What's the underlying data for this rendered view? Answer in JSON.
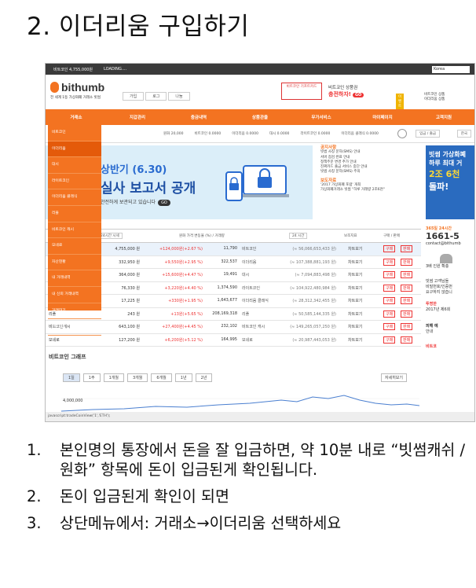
{
  "slide": {
    "title": "2. 이더리움 구입하기",
    "steps": [
      {
        "num": "1.",
        "text": "본인명의 통장에서 돈을 잘 입금하면, 약 10분 내로 “빗썸캐쉬 / 원화” 항목에 돈이 입금된게 확인됩니다."
      },
      {
        "num": "2.",
        "text": "돈이 입금된게 확인이 되면"
      },
      {
        "num": "3.",
        "text": "상단메뉴에서: 거래소→이더리움 선택하세요"
      }
    ]
  },
  "topbar": {
    "btc_price": "비트코인 4,755,000원",
    "loading": "LOADING....",
    "lang": "Korea"
  },
  "header": {
    "logo_text": "bithumb",
    "tagline": "전 세계 1등 가상화폐 거래소 빗썸",
    "buttons": [
      "가입",
      "로그",
      "나눔"
    ],
    "card_label": "비트코인 기프트카드",
    "ad_line1": "비트코인 상품권",
    "ad_line2": "충전하자!",
    "ad_go": "GO",
    "event_label": "이벤트",
    "right_link1": "비트코인 상품",
    "right_link2": "이더리움 상품"
  },
  "nav": [
    "거래소",
    "지갑관리",
    "충금내역",
    "상품관을",
    "무가서비스",
    "마이페이지",
    "고객지원"
  ],
  "ticker": [
    "원화 20,000",
    "비트코인 0.0000",
    "이더리움 0.0000",
    "대시 0.0000",
    "라이트코인 0.0000",
    "이더리움 클래식 0.0000"
  ],
  "ticker_buttons": [
    "입금 / 출금",
    "한국"
  ],
  "dropdown": {
    "items": [
      "비트코인",
      "이더리움",
      "대시",
      "라이트코인",
      "이더리움 클래식",
      "리플",
      "비트코인 캐시",
      "모네로",
      "자산현황",
      "내 거래내역",
      "내 신뢰 거래내역",
      "거래대기",
      "거래현황"
    ],
    "active_index": 1
  },
  "banner": {
    "line1": "상반기 (6.30)",
    "line2": "실사 보고서 공개",
    "line3": "안전하게 보관되고 있습니다",
    "go": "GO"
  },
  "notice": {
    "title1": "공지사항",
    "items1": [
      "빗썸 사칭 문자(SMS) 안내",
      "서버 점검 완료 안내",
      "정책주문 변경 추가 안내",
      "진짜카드 출금 서비스 중단 안내",
      "빗썸 사칭 문자(SMS) 주의"
    ],
    "title2": "보도자료",
    "items2": [
      "'2017 가상화폐 포럼' 개최",
      "가상화폐거래소 빗썸 \"하루 거래량 2조6천\""
    ]
  },
  "right_ad": {
    "line1": "빗썸 가상화폐",
    "line2": "하루 최대 거",
    "line3": "2조 6천",
    "line4": "돌파!"
  },
  "table": {
    "header": {
      "time": "24시간 시세",
      "change": "원화 가격 변동율 (%) / 거래량",
      "period": "24 시간",
      "index": "보조지표",
      "action": "구매 / 판매"
    },
    "rows": [
      {
        "name": "",
        "price": "4,755,000 원",
        "chg": "+124,000원(+2.67 %)",
        "vol": "11,790",
        "unit": "비트코인",
        "tot": "(≈ 56,066,653,433 원)",
        "chart": "차트보기",
        "buy": "구매",
        "sell": "판매"
      },
      {
        "name": "",
        "price": "332,950 원",
        "chg": "+9,550원(+2.95 %)",
        "vol": "322,537",
        "unit": "이더리움",
        "tot": "(≈ 107,388,881,193 원)",
        "chart": "차트보기",
        "buy": "구매",
        "sell": "판매"
      },
      {
        "name": "",
        "price": "364,000 원",
        "chg": "+15,600원(+4.47 %)",
        "vol": "19,491",
        "unit": "대시",
        "tot": "(≈ 7,094,883,498 원)",
        "chart": "차트보기",
        "buy": "구매",
        "sell": "판매"
      },
      {
        "name": "",
        "price": "76,330 원",
        "chg": "+3,220원(+4.40 %)",
        "vol": "1,374,590",
        "unit": "라이트코인",
        "tot": "(≈ 104,922,480,984 원)",
        "chart": "차트보기",
        "buy": "구매",
        "sell": "판매"
      },
      {
        "name": "",
        "price": "17,225 원",
        "chg": "+330원(+1.95 %)",
        "vol": "1,643,677",
        "unit": "이더리움 클래식",
        "tot": "(≈ 28,312,342,455 원)",
        "chart": "차트보기",
        "buy": "구매",
        "sell": "판매"
      },
      {
        "name": "리플",
        "price": "243 원",
        "chg": "+13원(+5.65 %)",
        "vol": "208,169,318",
        "unit": "리플",
        "tot": "(≈ 50,585,144,335 원)",
        "chart": "차트보기",
        "buy": "구매",
        "sell": "판매"
      },
      {
        "name": "비트코인캐시",
        "price": "643,100 원",
        "chg": "+27,400원(+4.45 %)",
        "vol": "232,102",
        "unit": "비트코인 캐시",
        "tot": "(≈ 149,265,057,250 원)",
        "chart": "차트보기",
        "buy": "구매",
        "sell": "판매"
      },
      {
        "name": "모네로",
        "price": "127,200 원",
        "chg": "+6,200원(+5.12 %)",
        "vol": "164,995",
        "unit": "모네로",
        "tot": "(≈ 20,987,443,053 원)",
        "chart": "차트보기",
        "buy": "구매",
        "sell": "판매"
      }
    ]
  },
  "graph": {
    "title": "비트코인 그래프",
    "tabs": [
      "1일",
      "1주",
      "1개월",
      "3개월",
      "6개월",
      "1년",
      "2년"
    ],
    "detail_button": "자세히보기",
    "y_label": "4,000,000"
  },
  "sidebar_right": {
    "text1": "365일 24시간",
    "phone": "1661-5",
    "email": "contact@bithumb",
    "people": "3배 인원 확충",
    "text2": "빗썸 고객님들",
    "text3": "비밀번호/인증번",
    "text4": "요구하지 않습니",
    "promo1": "투명한",
    "promo2": "2017년 제6회",
    "promo3": "피해 예",
    "promo4": "안내",
    "promo5": "비트코"
  },
  "statusbar": "javascript:tradeCoinView('1','ETH');"
}
